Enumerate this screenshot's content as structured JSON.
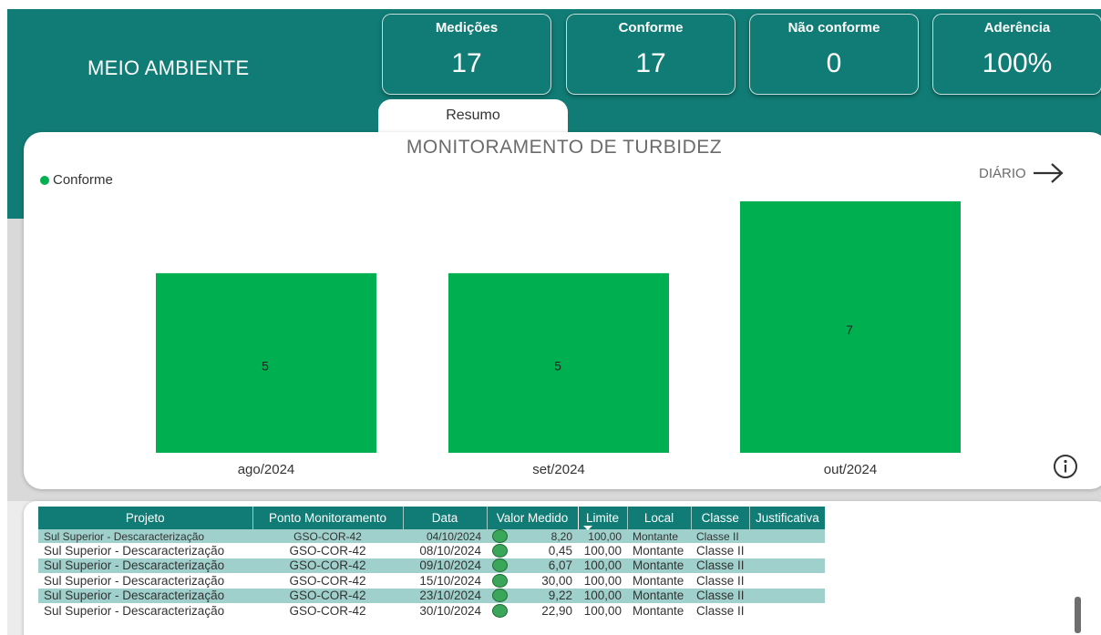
{
  "header": {
    "title": "MEIO AMBIENTE",
    "kpis": [
      {
        "label": "Medições",
        "value": "17"
      },
      {
        "label": "Conforme",
        "value": "17"
      },
      {
        "label": "Não conforme",
        "value": "0"
      },
      {
        "label": "Aderência",
        "value": "100%"
      }
    ],
    "tab_label": "Resumo"
  },
  "colors": {
    "brand_teal": "#107c75",
    "conforme_green": "#00b050",
    "table_alt_row": "#9fd0cc"
  },
  "chart": {
    "title": "MONITORAMENTO DE TURBIDEZ",
    "legend_label": "Conforme",
    "nav_label": "DIÁRIO",
    "nav_icon": "arrow-right-icon",
    "info_icon": "info-icon"
  },
  "chart_data": {
    "type": "bar",
    "title": "MONITORAMENTO DE TURBIDEZ",
    "categories": [
      "ago/2024",
      "set/2024",
      "out/2024"
    ],
    "series": [
      {
        "name": "Conforme",
        "values": [
          5,
          5,
          7
        ],
        "color": "#00b050"
      }
    ],
    "ylim": [
      0,
      7
    ],
    "data_labels": true,
    "grid": false,
    "legend_position": "top-left"
  },
  "table": {
    "columns": [
      "Projeto",
      "Ponto Monitoramento",
      "Data",
      "Valor Medido",
      "Limite",
      "Local",
      "Classe",
      "Justificativa"
    ],
    "sorted_column": "Limite",
    "partial_row": {
      "projeto": "Sul Superior - Descaracterização",
      "ponto": "GSO-COR-42",
      "data": "04/10/2024",
      "valor": "8,20",
      "limite": "100,00",
      "local": "Montante",
      "classe": "Classe II",
      "justificativa": ""
    },
    "rows": [
      {
        "projeto": "Sul Superior - Descaracterização",
        "ponto": "GSO-COR-42",
        "data": "08/10/2024",
        "valor": "0,45",
        "limite": "100,00",
        "local": "Montante",
        "classe": "Classe II",
        "justificativa": ""
      },
      {
        "projeto": "Sul Superior - Descaracterização",
        "ponto": "GSO-COR-42",
        "data": "09/10/2024",
        "valor": "6,07",
        "limite": "100,00",
        "local": "Montante",
        "classe": "Classe II",
        "justificativa": ""
      },
      {
        "projeto": "Sul Superior - Descaracterização",
        "ponto": "GSO-COR-42",
        "data": "15/10/2024",
        "valor": "30,00",
        "limite": "100,00",
        "local": "Montante",
        "classe": "Classe II",
        "justificativa": ""
      },
      {
        "projeto": "Sul Superior - Descaracterização",
        "ponto": "GSO-COR-42",
        "data": "23/10/2024",
        "valor": "9,22",
        "limite": "100,00",
        "local": "Montante",
        "classe": "Classe II",
        "justificativa": ""
      },
      {
        "projeto": "Sul Superior - Descaracterização",
        "ponto": "GSO-COR-42",
        "data": "30/10/2024",
        "valor": "22,90",
        "limite": "100,00",
        "local": "Montante",
        "classe": "Classe II",
        "justificativa": ""
      }
    ],
    "status_icon": "status-circle-icon"
  }
}
